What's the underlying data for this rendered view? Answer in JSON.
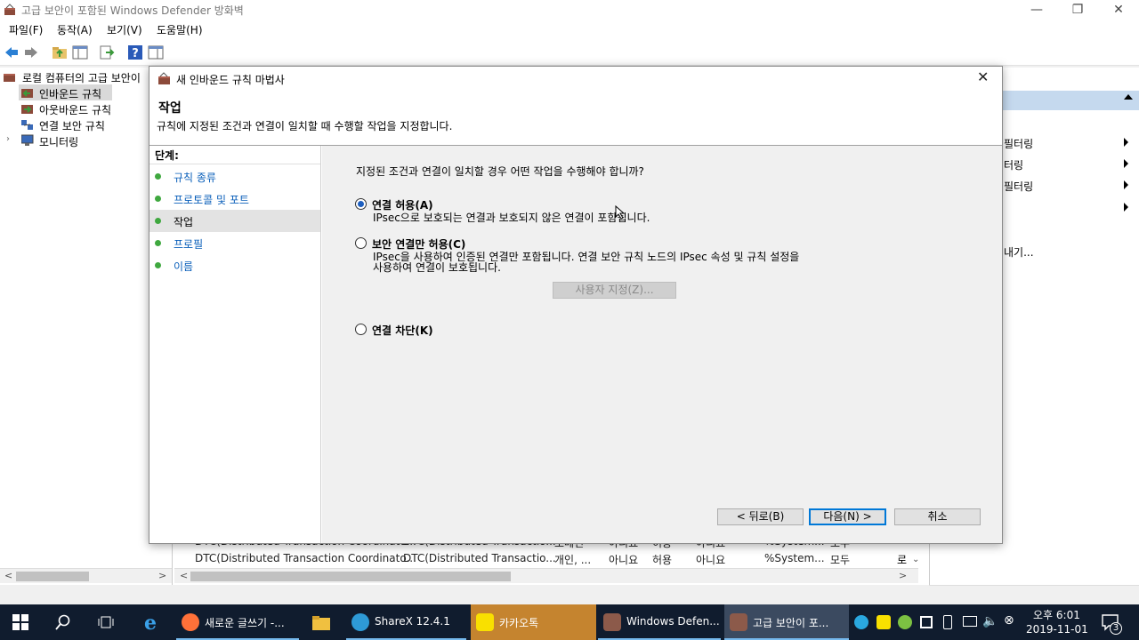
{
  "window": {
    "title": "고급 보안이 포함된 Windows Defender 방화벽",
    "minimize": "—",
    "maximize": "❐",
    "close": "✕"
  },
  "menu": [
    "파일(F)",
    "동작(A)",
    "보기(V)",
    "도움말(H)"
  ],
  "tree": {
    "root": "로컬 컴퓨터의 고급 보안이",
    "items": [
      "인바운드 규칙",
      "아웃바운드 규칙",
      "연결 보안 규칙",
      "모니터링"
    ]
  },
  "table": {
    "rows": [
      [
        "DTC(Distributed Transaction Coordinato...",
        "DTC(Distributed Transactio...",
        "도메인",
        "아니요",
        "허용",
        "아니요",
        "%System...",
        "모두"
      ],
      [
        "DTC(Distributed Transaction Coordinato...",
        "DTC(Distributed Transactio...",
        "개인, ...",
        "아니요",
        "허용",
        "아니요",
        "%System...",
        "모두"
      ]
    ]
  },
  "actions": {
    "items": [
      "필터링",
      "터링",
      "필터링",
      "내기..."
    ]
  },
  "dialog": {
    "title": "새 인바운드 규칙 마법사",
    "close": "✕",
    "heading": "작업",
    "subheading": "규칙에 지정된 조건과 연결이 일치할 때 수행할 작업을 지정합니다.",
    "steps_header": "단계:",
    "steps": [
      "규칙 종류",
      "프로토콜 및 포트",
      "작업",
      "프로필",
      "이름"
    ],
    "current_step": 2,
    "question": "지정된 조건과 연결이 일치할 경우 어떤 작업을 수행해야 합니까?",
    "options": [
      {
        "label": "연결 허용(A)",
        "desc": [
          "IPsec으로 보호되는 연결과 보호되지 않은 연결이 포함됩니다."
        ],
        "selected": true
      },
      {
        "label": "보안 연결만 허용(C)",
        "desc": [
          "IPsec을 사용하여 인증된 연결만 포함됩니다. 연결 보안 규칙 노드의 IPsec 속성 및 규칙 설정을",
          "사용하여 연결이 보호됩니다."
        ],
        "selected": false
      },
      {
        "label": "연결 차단(K)",
        "desc": [],
        "selected": false
      }
    ],
    "customize_button": "사용자 지정(Z)...",
    "back_button": "< 뒤로(B)",
    "next_button": "다음(N) >",
    "cancel_button": "취소"
  },
  "taskbar": {
    "apps": [
      {
        "label": "새로운 글쓰기 -...",
        "icon": "firefox-icon",
        "color": "#ff7139"
      },
      {
        "label": "ShareX 12.4.1",
        "icon": "sharex-icon",
        "color": "#2e9ad6"
      },
      {
        "label": "카카오톡",
        "icon": "kakaotalk-icon",
        "color": "#f9e000"
      },
      {
        "label": "Windows Defen...",
        "icon": "firewall-icon",
        "color": "#8c5a4a"
      },
      {
        "label": "고급 보안이 포...",
        "icon": "firewall-icon",
        "color": "#8c5a4a"
      }
    ],
    "time": "오후 6:01",
    "date": "2019-11-01",
    "notifications": "3"
  }
}
